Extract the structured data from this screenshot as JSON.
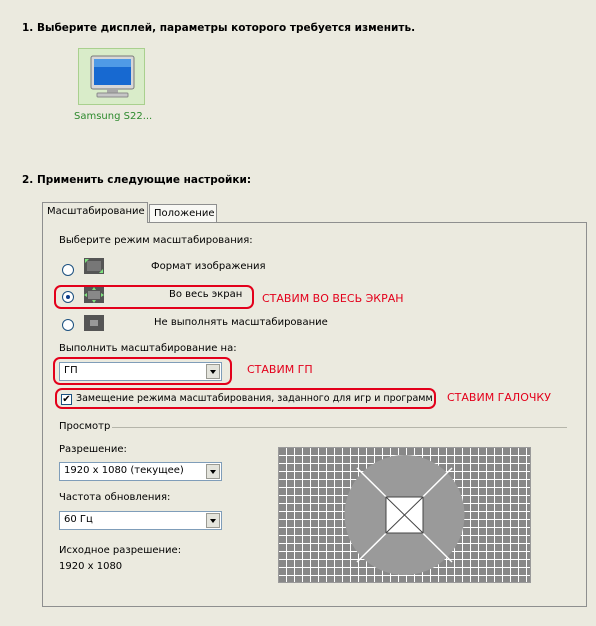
{
  "step1": {
    "title": "1. Выберите дисплей, параметры которого требуется изменить."
  },
  "display": {
    "label": "Samsung S22..."
  },
  "step2": {
    "title": "2. Применить следующие настройки:"
  },
  "tabs": [
    {
      "label": "Масштабирование"
    },
    {
      "label": "Положение"
    }
  ],
  "scaling": {
    "mode_heading": "Выберите режим масштабирования:",
    "modes": [
      {
        "label": "Формат изображения",
        "selected": false
      },
      {
        "label": "Во весь экран",
        "selected": true
      },
      {
        "label": "Не выполнять масштабирование",
        "selected": false
      }
    ],
    "perform_on_label": "Выполнить масштабирование на:",
    "perform_on_value": "ГП",
    "override_checkbox_label": "Замещение режима масштабирования, заданного для игр и программ",
    "override_checked": true
  },
  "preview": {
    "heading": "Просмотр",
    "resolution_label": "Разрешение:",
    "resolution_value": "1920 x 1080 (текущее)",
    "refresh_label": "Частота обновления:",
    "refresh_value": "60 Гц",
    "native_label": "Исходное разрешение:",
    "native_value": "1920 x 1080"
  },
  "annotations": {
    "fullscreen_note": "СТАВИМ ВО ВЕСЬ ЭКРАН",
    "gpu_note": "СТАВИМ ГП",
    "checkbox_note": "СТАВИМ ГАЛОЧКУ",
    "color": "#e3001b"
  },
  "colors": {
    "background": "#ebeadf",
    "selected_display": "#d9ecc9",
    "display_label": "#2d8a2d"
  }
}
